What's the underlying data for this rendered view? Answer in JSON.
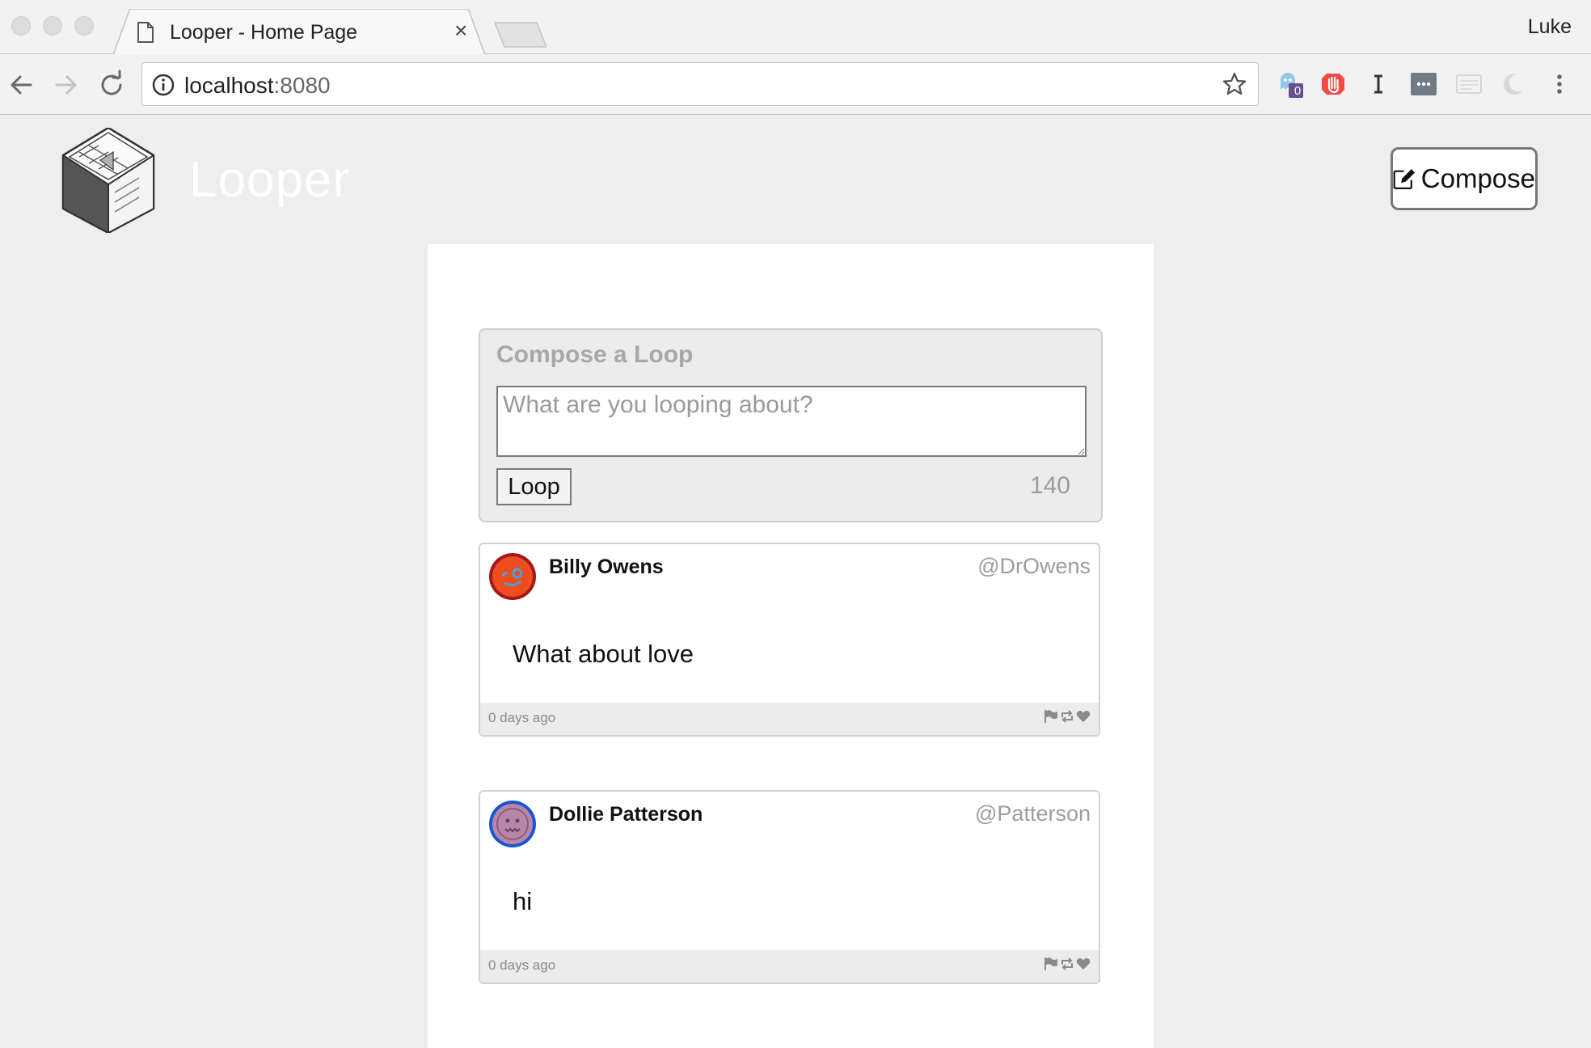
{
  "browser": {
    "tab_title": "Looper - Home Page",
    "close_glyph": "×",
    "profile_name": "Luke",
    "url_host": "localhost",
    "url_port": ":8080",
    "extension_badge": "0"
  },
  "header": {
    "brand": "Looper",
    "compose_label": "Compose"
  },
  "compose": {
    "title": "Compose a Loop",
    "placeholder": "What are you looping about?",
    "submit_label": "Loop",
    "char_count": "140"
  },
  "loops": [
    {
      "name": "Billy Owens",
      "handle": "@DrOwens",
      "text": "What about love",
      "time": "0 days ago",
      "avatar_color": "#ee4b1f",
      "avatar_ring": "#a41818"
    },
    {
      "name": "Dollie Patterson",
      "handle": "@Patterson",
      "text": "hi",
      "time": "0 days ago",
      "avatar_color": "#b886a8",
      "avatar_ring": "#1a55d6"
    }
  ],
  "colors": {
    "page_bg": "#eeeeee",
    "feed_bg": "#ffffff",
    "muted_text": "#9d9d9d"
  }
}
